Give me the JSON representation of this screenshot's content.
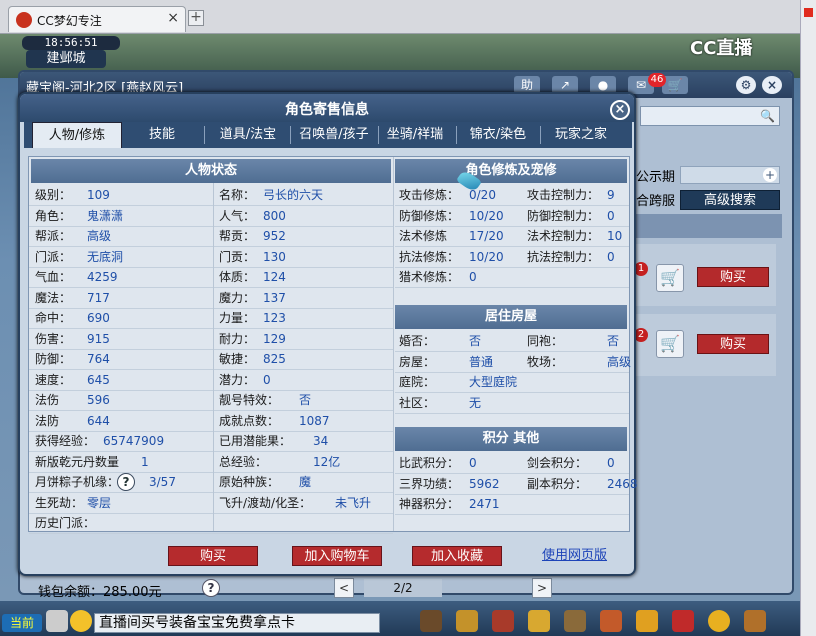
{
  "browser": {
    "tab_title": "CC梦幻专注",
    "tab_close": "×",
    "new_tab": "+"
  },
  "scene": {
    "clock": "18:56:51",
    "city": "建邺城",
    "logo": "CC直播"
  },
  "back_panel": {
    "title": "藏宝阁-河北2区 [燕赵风云]",
    "help_label": "助",
    "message_count": "46",
    "gongshi_label": "公示期",
    "kuafu_label": "合跨服",
    "advanced_search": "高级搜索",
    "row1_number": "1",
    "row2_number": "2",
    "buy_label": "购买",
    "wallet": "钱包余额：285.00元",
    "help_q": "?",
    "pager": {
      "prev": "<",
      "value": "2/2",
      "next": ">"
    }
  },
  "dialog": {
    "title": "角色寄售信息",
    "close": "×",
    "tabs": [
      "人物/修炼",
      "技能",
      "道具/法宝",
      "召唤兽/孩子",
      "坐骑/祥瑞",
      "锦衣/染色",
      "玩家之家"
    ],
    "sections": {
      "status": "人物状态",
      "cultivation": "角色修炼及宠修",
      "house": "居住房屋",
      "points": "积分 其他"
    },
    "status_left": [
      {
        "label": "级别：",
        "value": "109"
      },
      {
        "label": "角色：",
        "value": "鬼潇潇"
      },
      {
        "label": "帮派：",
        "value": "高级"
      },
      {
        "label": "门派：",
        "value": "无底洞"
      },
      {
        "label": "气血：",
        "value": "4259"
      },
      {
        "label": "魔法：",
        "value": "717"
      },
      {
        "label": "命中：",
        "value": "690"
      },
      {
        "label": "伤害：",
        "value": "915"
      },
      {
        "label": "防御：",
        "value": "764"
      },
      {
        "label": "速度：",
        "value": "645"
      },
      {
        "label": "法伤",
        "value": "596"
      },
      {
        "label": "法防",
        "value": "644"
      },
      {
        "label": "获得经验：",
        "value": "65747909"
      },
      {
        "label": "新版乾元丹数量",
        "value": "1"
      },
      {
        "label": "月饼粽子机缘：",
        "value": "3/57"
      },
      {
        "label": "生死劫：",
        "value": "零层"
      },
      {
        "label": "历史门派：",
        "value": ""
      }
    ],
    "status_right": [
      {
        "label": "名称：",
        "value": "弓长的六天"
      },
      {
        "label": "人气：",
        "value": "800"
      },
      {
        "label": "帮贡：",
        "value": "952"
      },
      {
        "label": "门贡：",
        "value": "130"
      },
      {
        "label": "体质：",
        "value": "124"
      },
      {
        "label": "魔力：",
        "value": "137"
      },
      {
        "label": "力量：",
        "value": "123"
      },
      {
        "label": "耐力：",
        "value": "129"
      },
      {
        "label": "敏捷：",
        "value": "825"
      },
      {
        "label": "潜力：",
        "value": "0"
      },
      {
        "label": "靓号特效：",
        "value": "否"
      },
      {
        "label": "成就点数：",
        "value": "1087"
      },
      {
        "label": "已用潜能果：",
        "value": "34"
      },
      {
        "label": "总经验：",
        "value": "12亿"
      },
      {
        "label": "原始种族：",
        "value": "魔"
      },
      {
        "label": "飞升/渡劫/化圣：",
        "value": "未飞升"
      }
    ],
    "cultivation": [
      {
        "label": "攻击修炼：",
        "value": "0/20",
        "label2": "攻击控制力：",
        "value2": "9"
      },
      {
        "label": "防御修炼：",
        "value": "10/20",
        "label2": "防御控制力：",
        "value2": "0"
      },
      {
        "label": "法术修炼",
        "value": "17/20",
        "label2": "法术控制力：",
        "value2": "10"
      },
      {
        "label": "抗法修炼：",
        "value": "10/20",
        "label2": "抗法控制力：",
        "value2": "0"
      },
      {
        "label": "猎术修炼：",
        "value": "0",
        "label2": "",
        "value2": ""
      }
    ],
    "house": [
      {
        "label": "婚否：",
        "value": "否",
        "label2": "同袍：",
        "value2": "否"
      },
      {
        "label": "房屋：",
        "value": "普通",
        "label2": "牧场：",
        "value2": "高级"
      },
      {
        "label": "庭院：",
        "value": "大型庭院",
        "label2": "",
        "value2": ""
      },
      {
        "label": "社区：",
        "value": "无",
        "label2": "",
        "value2": ""
      }
    ],
    "points": [
      {
        "label": "比武积分：",
        "value": "0",
        "label2": "剑会积分：",
        "value2": "0"
      },
      {
        "label": "三界功绩：",
        "value": "5962",
        "label2": "副本积分：",
        "value2": "2468"
      },
      {
        "label": "神器积分：",
        "value": "2471",
        "label2": "",
        "value2": ""
      }
    ],
    "question_mark": "?",
    "buttons": {
      "buy": "购买",
      "add_cart": "加入购物车",
      "add_fav": "加入收藏",
      "web": "使用网页版"
    }
  },
  "bottombar": {
    "current": "当前",
    "chat_text": "直播间买号装备宝宝免费拿点卡"
  }
}
